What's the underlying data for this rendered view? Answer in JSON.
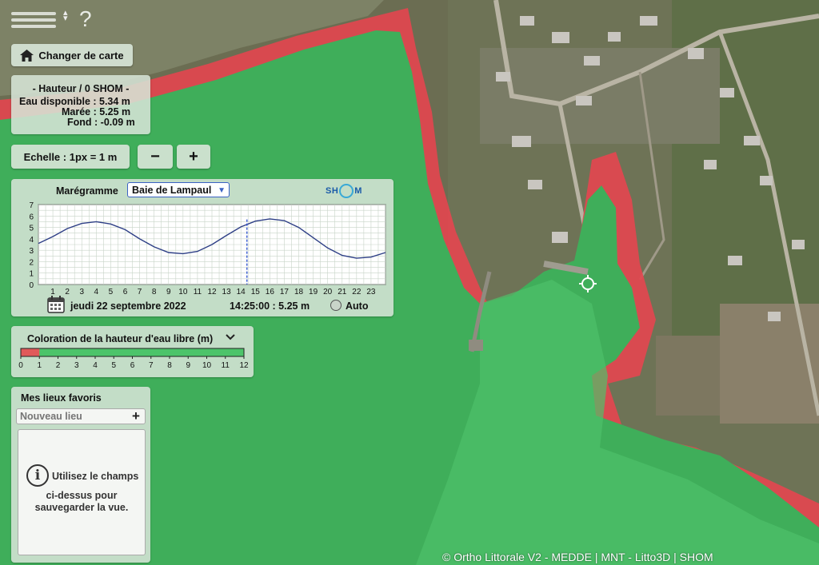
{
  "toolbar": {
    "menu_icon": "hamburger-icon",
    "sort_icon": "sort-icon",
    "help_glyph": "?",
    "changer_label": "Changer de carte",
    "changer_icon": "home-icon"
  },
  "hauteur": {
    "title": "- Hauteur / 0 SHOM -",
    "eau_disponible": "Eau disponible : 5.34 m",
    "maree": "Marée : 5.25 m",
    "fond": "Fond : -0.09 m"
  },
  "echelle": {
    "label": "Echelle : 1px = 1 m",
    "minus": "−",
    "plus": "+"
  },
  "maregramme": {
    "title": "Marégramme",
    "selected_port": "Baie de Lampaul",
    "logo": "SH M",
    "date": "jeudi 22 septembre 2022",
    "time_height": "14:25:00 : 5.25 m",
    "auto_label": "Auto"
  },
  "chart_data": {
    "type": "line",
    "title": "",
    "xlabel": "",
    "ylabel": "",
    "xlim": [
      0,
      24
    ],
    "ylim": [
      0,
      7
    ],
    "x_ticks": [
      1,
      2,
      3,
      4,
      5,
      6,
      7,
      8,
      9,
      10,
      11,
      12,
      13,
      14,
      15,
      16,
      17,
      18,
      19,
      20,
      21,
      22,
      23
    ],
    "y_ticks": [
      0,
      1,
      2,
      3,
      4,
      5,
      6,
      7
    ],
    "grid": true,
    "series": [
      {
        "x": [
          0,
          1,
          2,
          3,
          4,
          5,
          6,
          7,
          8,
          9,
          10,
          11,
          12,
          13,
          14,
          15,
          16,
          17,
          18,
          19,
          20,
          21,
          22,
          23,
          24
        ],
        "y": [
          3.6,
          4.2,
          4.9,
          5.35,
          5.5,
          5.3,
          4.8,
          4.0,
          3.3,
          2.8,
          2.7,
          2.9,
          3.5,
          4.3,
          5.05,
          5.55,
          5.75,
          5.6,
          5.0,
          4.1,
          3.2,
          2.55,
          2.3,
          2.4,
          2.8
        ]
      }
    ],
    "current_time_marker": 14.42
  },
  "coloration": {
    "title": "Coloration de la hauteur d'eau libre (m)",
    "scale_ticks": [
      "0",
      "1",
      "2",
      "3",
      "4",
      "5",
      "6",
      "7",
      "8",
      "9",
      "10",
      "11",
      "12"
    ],
    "scale_max": 12,
    "red_until": 1,
    "colors": {
      "low": "#e05a5a",
      "high": "#4cc46a"
    }
  },
  "favoris": {
    "title": "Mes lieux favoris",
    "input_placeholder": "Nouveau lieu",
    "add_glyph": "+",
    "info_glyph": "i",
    "message_line1": "Utilisez le champs",
    "message_line2": "ci-dessus pour",
    "message_line3": "sauvegarder la vue."
  },
  "attribution": "© Ortho Littorale V2 - MEDDE | MNT - Litto3D | SHOM",
  "colors": {
    "water_green": "#3fae5a",
    "danger_red": "#e2474f",
    "panel_bg": "#d6e4d6",
    "accent_blue": "#3b62c4"
  }
}
